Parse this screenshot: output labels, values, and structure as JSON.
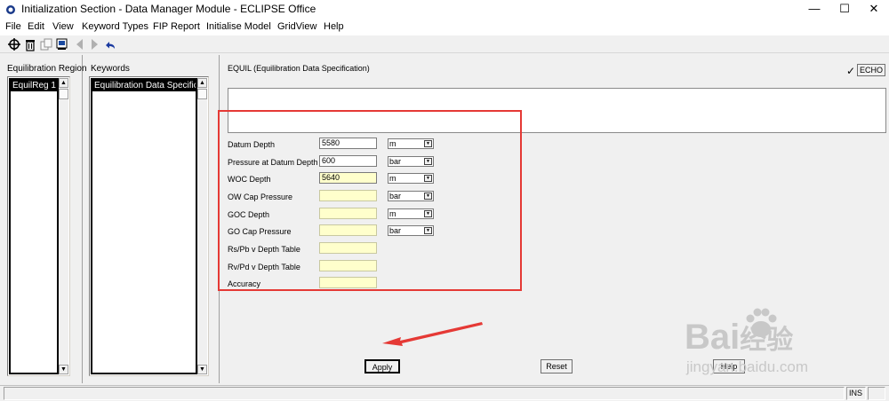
{
  "window": {
    "title": "Initialization Section - Data Manager Module - ECLIPSE Office",
    "minimize_glyph": "—",
    "maximize_glyph": "☐",
    "close_glyph": "✕"
  },
  "menu": {
    "items": [
      "File",
      "Edit",
      "View",
      "Keyword Types",
      "FIP Report",
      "Initialise Model",
      "GridView",
      "Help"
    ]
  },
  "toolbar": {
    "icons": [
      "crosshair-icon",
      "delete-icon",
      "copy-icon",
      "print-preview-icon",
      "back-arrow-icon",
      "forward-arrow-icon",
      "undo-icon"
    ]
  },
  "equilibration_region": {
    "label": "Equilibration Region",
    "items": [
      "EquilReg 1"
    ]
  },
  "keywords": {
    "label": "Keywords",
    "items": [
      "Equilibration Data Specification"
    ]
  },
  "equil": {
    "heading": "EQUIL (Equilibration Data Specification)",
    "echo_label": "ECHO",
    "check_glyph": "✓",
    "comment_text": "",
    "fields": [
      {
        "label": "Datum Depth",
        "value": "5580",
        "unit": "m"
      },
      {
        "label": "Pressure at Datum Depth",
        "value": "600",
        "unit": "bar"
      },
      {
        "label": "WOC Depth",
        "value": "5640",
        "unit": "m"
      },
      {
        "label": "OW Cap Pressure",
        "value": "",
        "unit": "bar"
      },
      {
        "label": "GOC Depth",
        "value": "",
        "unit": "m"
      },
      {
        "label": "GO Cap Pressure",
        "value": "",
        "unit": "bar"
      },
      {
        "label": "Rs/Pb v Depth Table",
        "value": ""
      },
      {
        "label": "Rv/Pd v Depth Table",
        "value": ""
      },
      {
        "label": "Accuracy",
        "value": ""
      }
    ]
  },
  "buttons": {
    "apply": "Apply",
    "reset": "Reset",
    "help": "Help"
  },
  "statusbar": {
    "mode": "INS"
  },
  "watermark": {
    "line1": "Bai",
    "line1b": "经验",
    "line2": "jingyan.baidu.com"
  },
  "colors": {
    "highlight_box": "#e53935",
    "field_empty": "#ffffcc"
  }
}
